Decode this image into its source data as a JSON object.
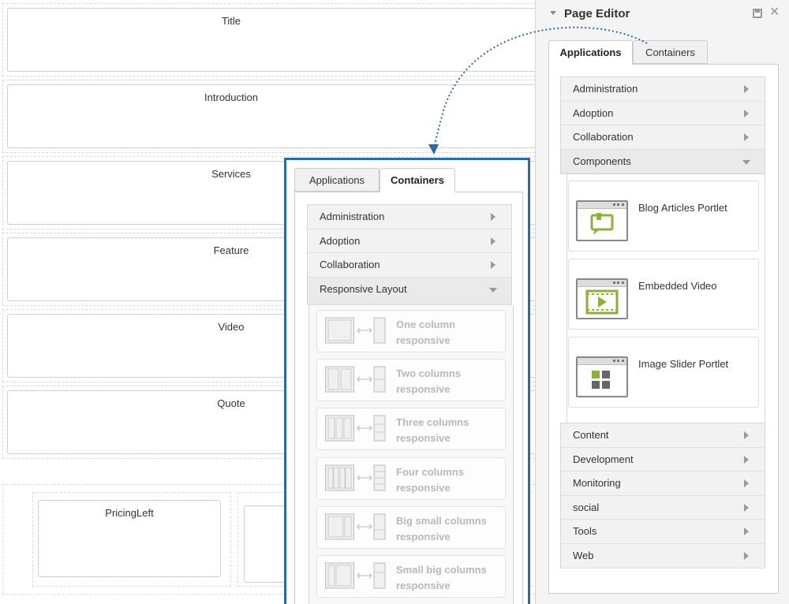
{
  "canvas": {
    "zones": [
      "Title",
      "Introduction",
      "Services",
      "Feature",
      "Video",
      "Quote"
    ],
    "pricing": {
      "left_label": "PricingLeft"
    }
  },
  "editor": {
    "title": "Page Editor",
    "tabs": {
      "applications": "Applications",
      "containers": "Containers"
    },
    "categories_top": [
      "Administration",
      "Adoption",
      "Collaboration"
    ],
    "open_category": "Components",
    "portlets": [
      "Blog Articles Portlet",
      "Embedded Video",
      "Image Slider Portlet"
    ],
    "categories_bottom": [
      "Content",
      "Development",
      "Monitoring",
      "social",
      "Tools",
      "Web"
    ]
  },
  "containers_panel": {
    "tabs": {
      "applications": "Applications",
      "containers": "Containers"
    },
    "categories": [
      "Administration",
      "Adoption",
      "Collaboration"
    ],
    "open_category": "Responsive Layout",
    "layouts": [
      {
        "line1": "One column",
        "line2": "responsive"
      },
      {
        "line1": "Two columns",
        "line2": "responsive"
      },
      {
        "line1": "Three columns",
        "line2": "responsive"
      },
      {
        "line1": "Four columns",
        "line2": "responsive"
      },
      {
        "line1": "Big small columns",
        "line2": "responsive"
      },
      {
        "line1": "Small big columns",
        "line2": "responsive"
      }
    ]
  },
  "colors": {
    "accent_blue": "#2e69a3",
    "portlet_green": "#8db03a"
  },
  "icons": [
    "collapse-icon",
    "save-icon",
    "close-icon",
    "chevron-right-icon",
    "chevron-down-icon",
    "blog-portlet-icon",
    "video-portlet-icon",
    "slider-portlet-icon",
    "layout-icon"
  ]
}
